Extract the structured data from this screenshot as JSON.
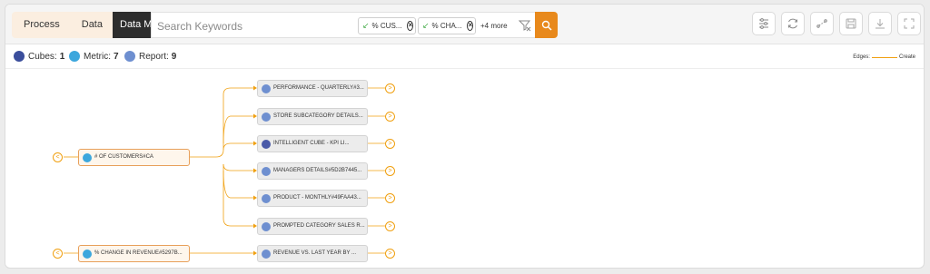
{
  "tabs": [
    "Process",
    "Data",
    "Data Model"
  ],
  "search": {
    "placeholder": "Search Keywords",
    "chips": [
      "% CUS...",
      "% CHA..."
    ],
    "more": "+4 more"
  },
  "toolbar_icons": [
    "settings-sliders-icon",
    "refresh-icon",
    "layout-icon",
    "save-icon",
    "download-icon",
    "fullscreen-icon"
  ],
  "stats": {
    "cubes_label": "Cubes:",
    "cubes_value": "1",
    "metric_label": "Metric:",
    "metric_value": "7",
    "report_label": "Report:",
    "report_value": "9"
  },
  "legend": {
    "edges_label": "Edges:",
    "create_label": "Create"
  },
  "colors": {
    "accent": "#e8891c",
    "edge": "#f0a010",
    "metric_icon": "#3ca7dd",
    "cube_icon": "#4a5aa8",
    "report_icon": "#6e8fd0"
  },
  "graph": {
    "sources": [
      {
        "label": "# OF CUSTOMERS#CA",
        "type": "metric"
      },
      {
        "label": "% CHANGE IN REVENUE#5297B...",
        "type": "metric"
      }
    ],
    "targets": [
      {
        "label": "PERFORMANCE - QUARTERLY#3...",
        "type": "report"
      },
      {
        "label": "STORE SUBCATEGORY DETAILS...",
        "type": "report"
      },
      {
        "label": "INTELLIGENT CUBE - KPI LI...",
        "type": "cube"
      },
      {
        "label": "MANAGERS DETAILS#5D2B7445...",
        "type": "report"
      },
      {
        "label": "PRODUCT - MONTHLY#49FAA43...",
        "type": "report"
      },
      {
        "label": "PROMPTED CATEGORY SALES R...",
        "type": "report"
      },
      {
        "label": "REVENUE VS. LAST YEAR BY ...",
        "type": "report"
      }
    ]
  }
}
